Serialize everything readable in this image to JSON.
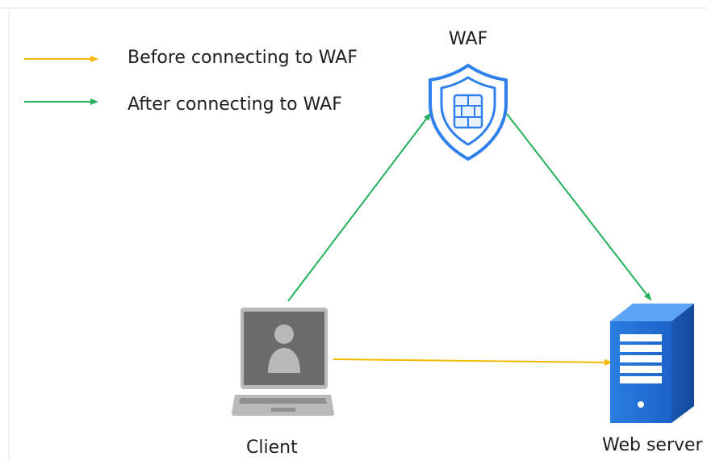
{
  "legend": {
    "before_label": "Before connecting to WAF",
    "after_label": "After connecting to WAF"
  },
  "nodes": {
    "waf_label": "WAF",
    "client_label": "Client",
    "server_label": "Web server"
  },
  "colors": {
    "before_arrow": "#f5b800",
    "after_arrow": "#22b15a",
    "waf_shield": "#2f80ed",
    "client_device": "#6b6b6b",
    "server": "#1f6fd6"
  },
  "icons": [
    "shield-icon",
    "laptop-user-icon",
    "server-icon"
  ]
}
